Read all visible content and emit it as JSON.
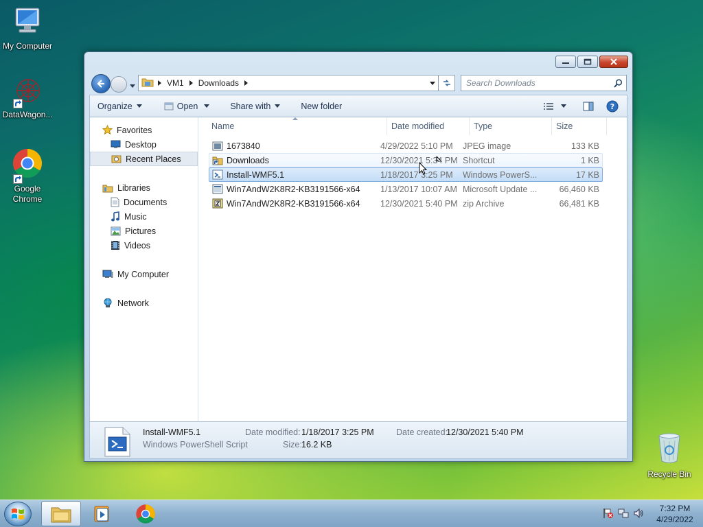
{
  "desktop": {
    "icons": [
      {
        "label": "My Computer"
      },
      {
        "label": "DataWagon..."
      },
      {
        "label": "Google Chrome"
      },
      {
        "label": "Recycle Bin"
      }
    ]
  },
  "window": {
    "breadcrumb": [
      "VM1",
      "Downloads"
    ],
    "search_placeholder": "Search Downloads",
    "toolbar": {
      "organize": "Organize",
      "open": "Open",
      "share_with": "Share with",
      "new_folder": "New folder"
    },
    "nav": {
      "favorites": "Favorites",
      "desktop": "Desktop",
      "recent_places": "Recent Places",
      "libraries": "Libraries",
      "documents": "Documents",
      "music": "Music",
      "pictures": "Pictures",
      "videos": "Videos",
      "my_computer": "My Computer",
      "network": "Network"
    },
    "columns": {
      "name": "Name",
      "date": "Date modified",
      "type": "Type",
      "size": "Size"
    },
    "files": [
      {
        "name": "1673840",
        "date": "4/29/2022 5:10 PM",
        "type": "JPEG image",
        "size": "133 KB",
        "icon": "jpeg-icon"
      },
      {
        "name": "Downloads",
        "date": "12/30/2021 5:34 PM",
        "type": "Shortcut",
        "size": "1 KB",
        "icon": "shortcut-icon"
      },
      {
        "name": "Install-WMF5.1",
        "date": "1/18/2017 3:25 PM",
        "type": "Windows PowerS...",
        "size": "17 KB",
        "icon": "powershell-script-icon"
      },
      {
        "name": "Win7AndW2K8R2-KB3191566-x64",
        "date": "1/13/2017 10:07 AM",
        "type": "Microsoft Update ...",
        "size": "66,460 KB",
        "icon": "msu-icon"
      },
      {
        "name": "Win7AndW2K8R2-KB3191566-x64",
        "date": "12/30/2021 5:40 PM",
        "type": "zip Archive",
        "size": "66,481 KB",
        "icon": "zip-icon"
      }
    ],
    "details": {
      "name": "Install-WMF5.1",
      "type": "Windows PowerShell Script",
      "date_modified_label": "Date modified:",
      "date_modified": "1/18/2017 3:25 PM",
      "size_label": "Size:",
      "size": "16.2 KB",
      "date_created_label": "Date created:",
      "date_created": "12/30/2021 5:40 PM"
    }
  },
  "taskbar": {
    "time": "7:32 PM",
    "date": "4/29/2022"
  }
}
